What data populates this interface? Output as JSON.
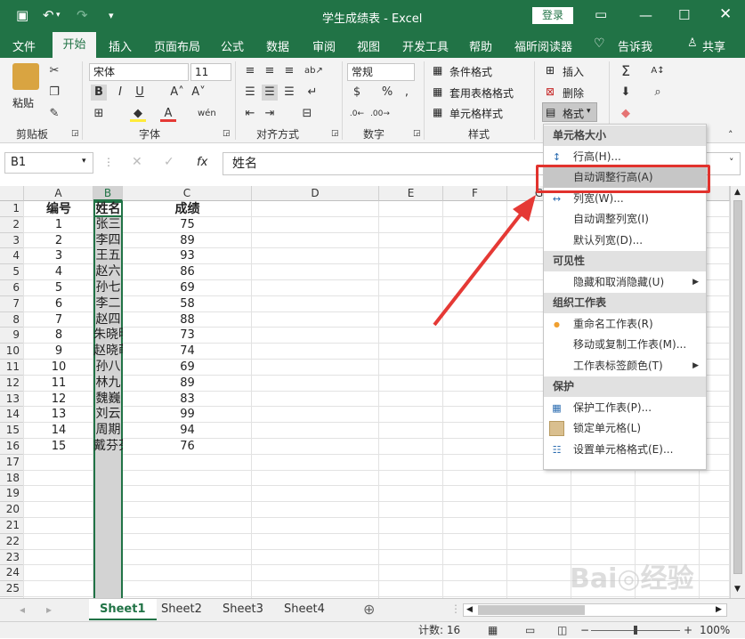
{
  "title": "学生成绩表 - Excel",
  "login_label": "登录",
  "tabs": [
    "文件",
    "开始",
    "插入",
    "页面布局",
    "公式",
    "数据",
    "审阅",
    "视图",
    "开发工具",
    "帮助",
    "福昕阅读器",
    "告诉我",
    "共享"
  ],
  "ribbon": {
    "clipboard_label": "剪贴板",
    "paste_label": "粘贴",
    "font_name": "宋体",
    "font_size": "11",
    "bold": "B",
    "italic": "I",
    "underline": "U",
    "font_label": "字体",
    "align_label": "对齐方式",
    "number_format": "常规",
    "number_label": "数字",
    "conditional_format": "条件格式",
    "table_format": "套用表格格式",
    "cell_style": "单元格样式",
    "styles_label": "样式",
    "insert_label": "插入",
    "delete_label": "删除",
    "format_label": "格式"
  },
  "formula_bar": {
    "name_box": "B1",
    "formula": "姓名",
    "fx": "fx"
  },
  "columns": [
    "A",
    "B",
    "C",
    "D",
    "E",
    "F",
    "G"
  ],
  "rows": [
    "1",
    "2",
    "3",
    "4",
    "5",
    "6",
    "7",
    "8",
    "9",
    "10",
    "11",
    "12",
    "13",
    "14",
    "15",
    "16",
    "17",
    "18",
    "19",
    "20",
    "21",
    "22",
    "23",
    "24",
    "25"
  ],
  "table": {
    "headers": [
      "编号",
      "姓名",
      "成绩"
    ],
    "data": [
      [
        "1",
        "张三",
        "75"
      ],
      [
        "2",
        "李四",
        "89"
      ],
      [
        "3",
        "王五",
        "93"
      ],
      [
        "4",
        "赵六",
        "86"
      ],
      [
        "5",
        "孙七",
        "69"
      ],
      [
        "6",
        "李二",
        "58"
      ],
      [
        "7",
        "赵四",
        "88"
      ],
      [
        "8",
        "朱晓明",
        "73"
      ],
      [
        "9",
        "赵晓萌",
        "74"
      ],
      [
        "10",
        "孙八",
        "69"
      ],
      [
        "11",
        "林九",
        "89"
      ],
      [
        "12",
        "魏巍",
        "83"
      ],
      [
        "13",
        "刘云",
        "99"
      ],
      [
        "14",
        "周期",
        "94"
      ],
      [
        "15",
        "戴芬芬",
        "76"
      ]
    ]
  },
  "sheets": [
    "Sheet1",
    "Sheet2",
    "Sheet3",
    "Sheet4"
  ],
  "status": {
    "count": "计数: 16",
    "zoom": "100%"
  },
  "menu": {
    "sections": [
      {
        "title": "单元格大小",
        "items": [
          {
            "label": "行高(H)...",
            "icon": "row-height-icon"
          },
          {
            "label": "自动调整行高(A)",
            "icon": ""
          },
          {
            "label": "列宽(W)...",
            "icon": "col-width-icon"
          },
          {
            "label": "自动调整列宽(I)",
            "icon": ""
          },
          {
            "label": "默认列宽(D)...",
            "icon": ""
          }
        ]
      },
      {
        "title": "可见性",
        "items": [
          {
            "label": "隐藏和取消隐藏(U)",
            "icon": "",
            "submenu": true
          }
        ]
      },
      {
        "title": "组织工作表",
        "items": [
          {
            "label": "重命名工作表(R)",
            "icon": "dot"
          },
          {
            "label": "移动或复制工作表(M)...",
            "icon": ""
          },
          {
            "label": "工作表标签颜色(T)",
            "icon": "",
            "submenu": true
          }
        ]
      },
      {
        "title": "保护",
        "items": [
          {
            "label": "保护工作表(P)...",
            "icon": "protect-sheet-icon"
          },
          {
            "label": "锁定单元格(L)",
            "icon": "lock-cell-icon"
          },
          {
            "label": "设置单元格格式(E)...",
            "icon": "format-cells-icon"
          }
        ]
      }
    ]
  },
  "colors": {
    "excel_green": "#217346",
    "highlight_red": "#e1322d",
    "selection_green": "#217346"
  }
}
